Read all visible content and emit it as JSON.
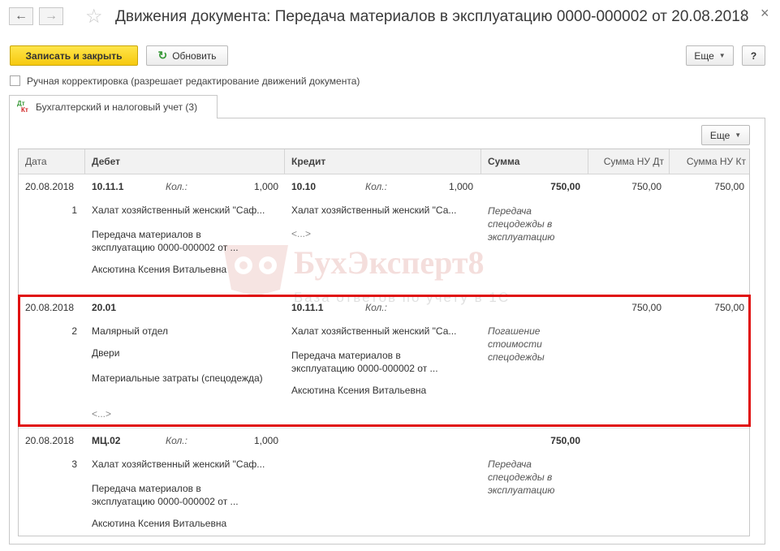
{
  "window": {
    "title": "Движения документа: Передача материалов в эксплуатацию 0000-000002 от 20.08.2018",
    "more_menu_glyph": "⋮",
    "close_glyph": "×"
  },
  "toolbar": {
    "save_close_label": "Записать и закрыть",
    "refresh_label": "Обновить",
    "more_label": "Еще",
    "help_label": "?"
  },
  "manual_edit": {
    "checked": false,
    "label": "Ручная корректировка (разрешает редактирование движений документа)"
  },
  "tab": {
    "icon_top": "Дт",
    "icon_bottom": "Кт",
    "label": "Бухгалтерский и налоговый учет (3)"
  },
  "grid_toolbar": {
    "more_label": "Еще"
  },
  "table": {
    "columns": [
      "Дата",
      "Дебет",
      "Кредит",
      "Сумма",
      "Сумма НУ Дт",
      "Сумма НУ Кт"
    ],
    "rows": [
      {
        "date": "20.08.2018",
        "num": "1",
        "debit_account": "10.11.1",
        "debit_qty_label": "Кол.:",
        "debit_qty": "1,000",
        "debit_sub1": "Халат хозяйственный женский \"Саф...",
        "debit_sub2": "Передача материалов в эксплуатацию 0000-000002 от ...",
        "debit_sub3": "Аксютина Ксения Витальевна",
        "credit_account": "10.10",
        "credit_qty_label": "Кол.:",
        "credit_qty": "1,000",
        "credit_sub1": "Халат хозяйственный женский \"Са...",
        "credit_sub2": "<...>",
        "amount": "750,00",
        "content": "Передача спецодежды в эксплуатацию",
        "nu_dt": "750,00",
        "nu_kt": "750,00"
      },
      {
        "date": "20.08.2018",
        "num": "2",
        "debit_account": "20.01",
        "debit_sub1": "Малярный отдел",
        "debit_sub2": "Двери",
        "debit_sub3": "Материальные затраты (спецодежда)",
        "debit_sub4": "<...>",
        "credit_account": "10.11.1",
        "credit_qty_label": "Кол.:",
        "credit_sub1": "Халат хозяйственный женский \"Са...",
        "credit_sub2": "Передача материалов в эксплуатацию 0000-000002 от ...",
        "credit_sub3": "Аксютина Ксения Витальевна",
        "content": "Погашение стоимости спецодежды",
        "nu_dt": "750,00",
        "nu_kt": "750,00"
      },
      {
        "date": "20.08.2018",
        "num": "3",
        "debit_account": "МЦ.02",
        "debit_qty_label": "Кол.:",
        "debit_qty": "1,000",
        "debit_sub1": "Халат хозяйственный женский \"Саф...",
        "debit_sub2": "Передача материалов в эксплуатацию 0000-000002 от ...",
        "debit_sub3": "Аксютина Ксения Витальевна",
        "amount": "750,00",
        "content": "Передача спецодежды в эксплуатацию"
      }
    ]
  },
  "watermark": {
    "brand": "БухЭксперт8",
    "tagline": "База ответов по учету в 1С"
  },
  "colors": {
    "primary_button": "#f6c90f",
    "highlight_border": "#e01010",
    "refresh_icon": "#3a9a3a",
    "watermark": "#c0392b"
  }
}
